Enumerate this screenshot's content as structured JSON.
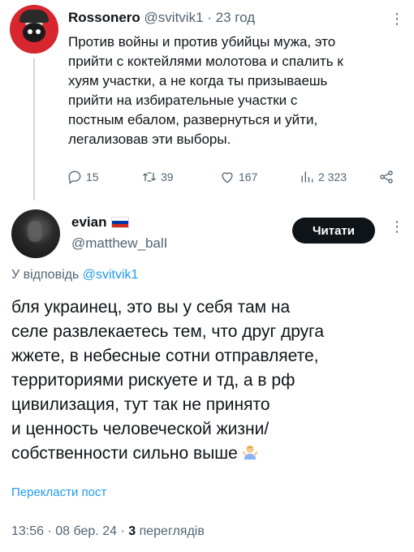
{
  "parent_tweet": {
    "name": "Rossonero",
    "handle": "@svitvik1",
    "dot": "·",
    "time": "23 год",
    "more": "⋮",
    "text": "Против войны и против убийцы мужа, это\nприйти с коктейлями молотова и спалить к\nхуям участки, а не когда ты призываешь\nприйти на избирательные участки с\nпостным ебалом, развернуться и уйти,\nлегализовав эти выборы.",
    "stats": {
      "replies": "15",
      "retweets": "39",
      "likes": "167",
      "views": "2 323"
    }
  },
  "main_tweet": {
    "name": "evian",
    "handle": "@matthew_balI",
    "follow_label": "Читати",
    "more": "⋮",
    "reply_prefix": "У відповідь",
    "reply_handle": "@svitvik1",
    "text": "бля украинец, это вы у себя там на\nселе развлекаетесь тем, что друг друга\nжжете, в небесные сотни отправляете,\nтерриториями рискуете и тд, а в рф\nцивилизация, тут так не принято\nи ценность человеческой жизни/\nсобственности сильно выше",
    "translate_label": "Перекласти пост",
    "time": "13:56",
    "date": "08 бер. 24",
    "views_count": "3",
    "views_label": "переглядів",
    "sep": "·"
  },
  "icons": {
    "reply": "reply-icon",
    "retweet": "retweet-icon",
    "like": "heart-icon",
    "views": "views-icon",
    "share": "share-icon",
    "flag": "russia-flag-icon",
    "emoji": "person-shrugging-emoji"
  },
  "colors": {
    "accent": "#1d9bf0",
    "text": "#0f1419",
    "muted": "#536471",
    "button": "#0f1419"
  }
}
